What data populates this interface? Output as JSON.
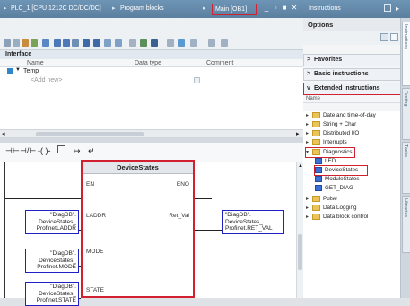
{
  "breadcrumb": {
    "items": [
      "PLC_1 [CPU 1212C DC/DC/DC]",
      "Program blocks",
      "Main [OB1]"
    ],
    "separator": "▸"
  },
  "window_controls": [
    "_",
    "▫",
    "■",
    "✕"
  ],
  "instructions_bar": {
    "title": "Instructions"
  },
  "interface": {
    "title": "Interface",
    "columns": [
      "Name",
      "Data type",
      "Comment"
    ],
    "rows": [
      {
        "name": "Temp"
      },
      {
        "name": "<Add new>"
      }
    ]
  },
  "network": {
    "block": {
      "title": "DeviceStates",
      "en": "EN",
      "eno": "ENO",
      "inputs": [
        "LADDR",
        "MODE",
        "STATE"
      ],
      "outputs": [
        "Ret_Val"
      ]
    },
    "operands": {
      "laddr": [
        "\"DiagDB\".",
        "DeviceStates_",
        "ProfinetLADDR"
      ],
      "mode": [
        "\"DiagDB\".",
        "DeviceStates_",
        "Profinet.MODE"
      ],
      "state": [
        "\"DiagDB\".",
        "DeviceStates_",
        "Profinet.STATE"
      ],
      "ret_val": [
        "\"DiagDB\".",
        "DeviceStates_",
        "Profinet.RET_VAL"
      ]
    }
  },
  "panel": {
    "options_title": "Options",
    "sections": [
      "Favorites",
      "Basic instructions",
      "Extended instructions"
    ],
    "tree_header": "Name",
    "tree": [
      {
        "label": "Date and time-of-day",
        "kind": "folder",
        "indent": 0,
        "expanded": false
      },
      {
        "label": "String + Char",
        "kind": "folder",
        "indent": 0,
        "expanded": false
      },
      {
        "label": "Distributed I/O",
        "kind": "folder",
        "indent": 0,
        "expanded": false
      },
      {
        "label": "Interrupts",
        "kind": "folder",
        "indent": 0,
        "expanded": false
      },
      {
        "label": "Diagnostics",
        "kind": "folder",
        "indent": 0,
        "expanded": true
      },
      {
        "label": "LED",
        "kind": "block",
        "indent": 1
      },
      {
        "label": "DeviceStates",
        "kind": "block",
        "indent": 1
      },
      {
        "label": "ModuleStates",
        "kind": "block",
        "indent": 1
      },
      {
        "label": "GET_DIAG",
        "kind": "block",
        "indent": 1
      },
      {
        "label": "Pulse",
        "kind": "folder",
        "indent": 0,
        "expanded": false
      },
      {
        "label": "Data Logging",
        "kind": "folder",
        "indent": 0,
        "expanded": false
      },
      {
        "label": "Data block control",
        "kind": "folder",
        "indent": 0,
        "expanded": false
      }
    ],
    "vertical_tabs": [
      "Instructions",
      "Testing",
      "Tasks",
      "Libraries"
    ]
  },
  "colors": {
    "title_bar": "#5a7f9f",
    "highlight_red": "#d12030",
    "operand_blue": "#2020c8",
    "folder_yellow": "#e9c45a",
    "block_blue": "#3a6fd6"
  }
}
